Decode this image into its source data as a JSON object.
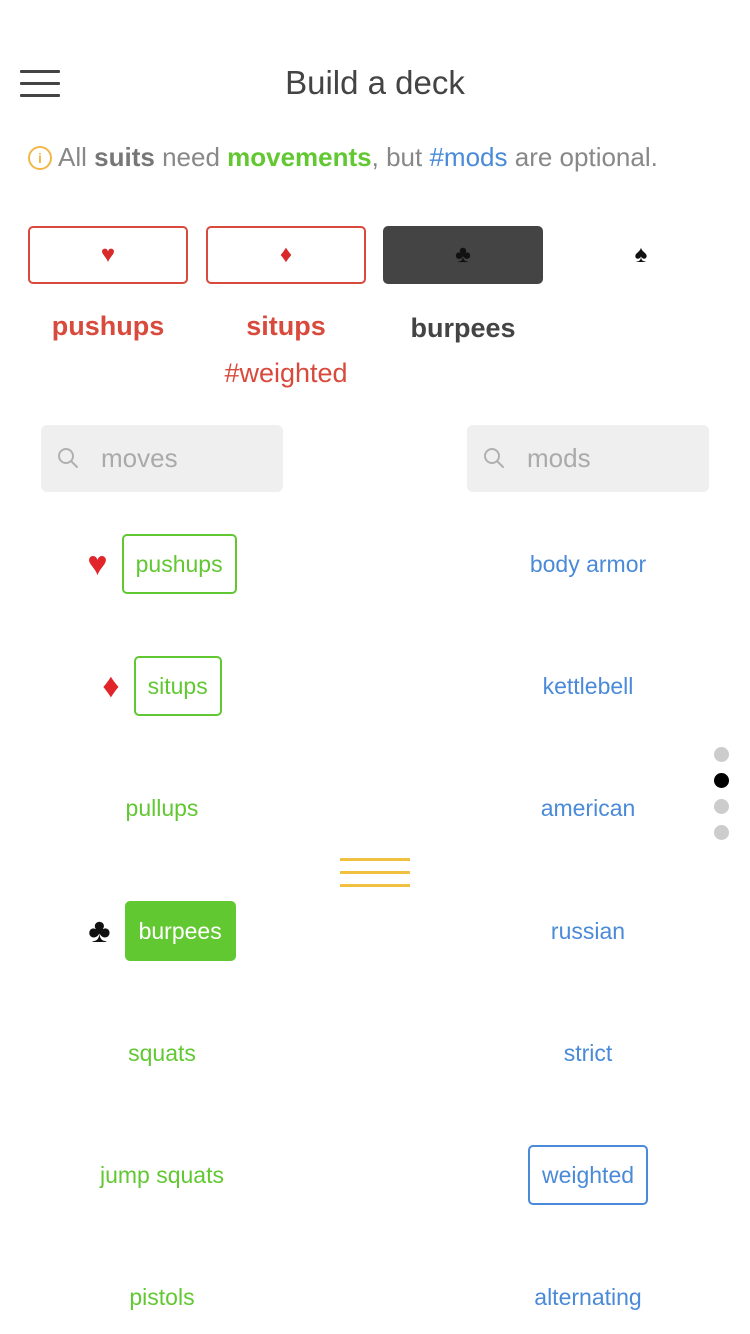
{
  "header": {
    "title": "Build a deck"
  },
  "info": {
    "icon": "i",
    "all": "All",
    "suits": "suits",
    "need": "need",
    "movements": "movements",
    "but": ", but",
    "mods": "#mods",
    "optional": "are optional."
  },
  "slots": [
    {
      "suit": "♥",
      "icon": "heart-icon",
      "move": "pushups",
      "mod": "",
      "state": "red"
    },
    {
      "suit": "♦",
      "icon": "diamond-icon",
      "move": "situps",
      "mod": "#weighted",
      "state": "red"
    },
    {
      "suit": "♣",
      "icon": "club-icon",
      "move": "burpees",
      "mod": "",
      "state": "dark"
    },
    {
      "suit": "♠",
      "icon": "spade-icon",
      "move": "",
      "mod": "",
      "state": "plain"
    }
  ],
  "search": {
    "moves_placeholder": "moves",
    "mods_placeholder": "mods"
  },
  "moves": [
    {
      "suit": "♥",
      "suit_icon": "heart-icon",
      "label": "pushups",
      "style": "outlined"
    },
    {
      "suit": "♦",
      "suit_icon": "diamond-icon",
      "label": "situps",
      "style": "outlined"
    },
    {
      "suit": "",
      "suit_icon": "",
      "label": "pullups",
      "style": "plain"
    },
    {
      "suit": "♣",
      "suit_icon": "club-icon",
      "label": "burpees",
      "style": "filled"
    },
    {
      "suit": "",
      "suit_icon": "",
      "label": "squats",
      "style": "plain"
    },
    {
      "suit": "",
      "suit_icon": "",
      "label": "jump squats",
      "style": "plain"
    },
    {
      "suit": "",
      "suit_icon": "",
      "label": "pistols",
      "style": "plain"
    }
  ],
  "mods": [
    {
      "label": "body armor",
      "style": "plain"
    },
    {
      "label": "kettlebell",
      "style": "plain"
    },
    {
      "label": "american",
      "style": "plain"
    },
    {
      "label": "russian",
      "style": "plain"
    },
    {
      "label": "strict",
      "style": "plain"
    },
    {
      "label": "weighted",
      "style": "outlined"
    },
    {
      "label": "alternating",
      "style": "plain"
    }
  ],
  "pagination": {
    "total": 4,
    "active": 1
  },
  "colors": {
    "move_green": "#62c832",
    "mod_blue": "#4a8ad8",
    "suit_red": "#d84a3c",
    "handle_yellow": "#f0c040",
    "info_orange": "#f0b84a"
  }
}
